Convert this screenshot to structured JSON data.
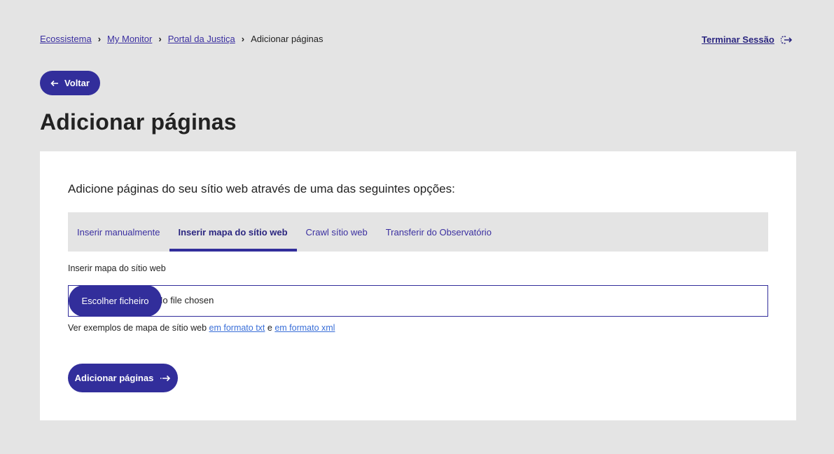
{
  "breadcrumb": {
    "items": [
      "Ecossistema",
      "My Monitor",
      "Portal da Justiça"
    ],
    "current": "Adicionar páginas"
  },
  "header": {
    "logout_label": "Terminar Sessão"
  },
  "back": {
    "label": "Voltar"
  },
  "page": {
    "title": "Adicionar páginas"
  },
  "card": {
    "intro": "Adicione páginas do seu sítio web através de uma das seguintes opções:",
    "tabs": [
      {
        "label": "Inserir manualmente",
        "active": false
      },
      {
        "label": "Inserir mapa do sítio web",
        "active": true
      },
      {
        "label": "Crawl sítio web",
        "active": false
      },
      {
        "label": "Transferir do Observatório",
        "active": false
      }
    ],
    "field_label": "Inserir mapa do sítio web",
    "file_button": "Escolher ficheiro",
    "file_status": "No file chosen",
    "examples": {
      "prefix": "Ver exemplos de mapa de sítio web ",
      "link_txt": "em formato txt",
      "conj": " e ",
      "link_xml": "em formato xml"
    },
    "submit": "Adicionar páginas"
  },
  "colors": {
    "primary": "#322e9b",
    "link": "#3a2fa0",
    "background": "#e4e4e4"
  },
  "icons": [
    "arrow-left-icon",
    "logout-icon",
    "arrow-right-icon",
    "chevron-right-icon"
  ]
}
